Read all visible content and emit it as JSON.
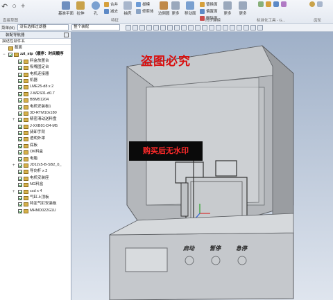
{
  "ribbon": {
    "quick_access": [
      "↶",
      "○",
      "+"
    ],
    "items": [
      {
        "label": "基准平面",
        "color": "#6f8fbf"
      },
      {
        "label": "拉伸",
        "color": "#c9a24a"
      },
      {
        "label": "孔",
        "color": "#7aa0d0"
      },
      {
        "label": "抽壳",
        "color": "#a8b6cc"
      },
      {
        "label": "边倒圆",
        "color": "#c08a4a"
      },
      {
        "label": "更多",
        "color": "#9aa8bc"
      },
      {
        "label": "移动面",
        "color": "#7aa0d0"
      },
      {
        "label": "更多",
        "color": "#9aa8bc"
      },
      {
        "label": "更多",
        "color": "#9aa8bc"
      }
    ],
    "small_items": [
      "合并",
      "减去",
      "拔模",
      "修剪体",
      "替换面",
      "偏置面",
      "删除面"
    ],
    "groups": [
      "直接草图",
      "特征",
      "同步建模",
      "标准化工具 - G...",
      "齿轮"
    ]
  },
  "selection_bar": {
    "menu_label": "菜单(M)",
    "filter_value": "没有选择过滤器",
    "assembly_value": "整个装配"
  },
  "nav": {
    "title": "装配导航器",
    "filter_label": "描述性部件名",
    "items": [
      {
        "label": "截面",
        "level": 0,
        "expander": "",
        "checkbox": false,
        "bold": false
      },
      {
        "label": "zzt_stp（顺序：时间顺序",
        "level": 0,
        "expander": "−",
        "checkbox": true,
        "bold": true
      },
      {
        "label": "料盒放置台",
        "level": 1,
        "expander": "",
        "checkbox": true,
        "bold": false
      },
      {
        "label": "吸嘴固定台",
        "level": 1,
        "expander": "",
        "checkbox": true,
        "bold": false
      },
      {
        "label": "电机连接器",
        "level": 1,
        "expander": "",
        "checkbox": true,
        "bold": false
      },
      {
        "label": "机器",
        "level": 1,
        "expander": "",
        "checkbox": true,
        "bold": false
      },
      {
        "label": "LME25-d8 x 2",
        "level": 1,
        "expander": "",
        "checkbox": true,
        "bold": false
      },
      {
        "label": "J-WES01-d0.7",
        "level": 1,
        "expander": "",
        "checkbox": true,
        "bold": false
      },
      {
        "label": "BBM51204",
        "level": 1,
        "expander": "",
        "checkbox": true,
        "bold": false
      },
      {
        "label": "电机安装板1",
        "level": 1,
        "expander": "",
        "checkbox": true,
        "bold": false
      },
      {
        "label": "3D-RTM10x180",
        "level": 1,
        "expander": "",
        "checkbox": true,
        "bold": false
      },
      {
        "label": "精密滑动送料盘",
        "level": 1,
        "expander": "+",
        "checkbox": true,
        "bold": false
      },
      {
        "label": "J-XXB01-D4-M5",
        "level": 1,
        "expander": "",
        "checkbox": true,
        "bold": false
      },
      {
        "label": "骑卸手臂",
        "level": 1,
        "expander": "",
        "checkbox": true,
        "bold": false
      },
      {
        "label": "透明外罩",
        "level": 1,
        "expander": "",
        "checkbox": true,
        "bold": false
      },
      {
        "label": "底板",
        "level": 1,
        "expander": "",
        "checkbox": true,
        "bold": false
      },
      {
        "label": "OK料盒",
        "level": 1,
        "expander": "",
        "checkbox": true,
        "bold": false
      },
      {
        "label": "电箱",
        "level": 1,
        "expander": "",
        "checkbox": true,
        "bold": false
      },
      {
        "label": "JD12x5-B-SB2_0_",
        "level": 1,
        "expander": "+",
        "checkbox": true,
        "bold": false
      },
      {
        "label": "导向杆 x 2",
        "level": 1,
        "expander": "",
        "checkbox": true,
        "bold": false
      },
      {
        "label": "电机安装座",
        "level": 1,
        "expander": "",
        "checkbox": true,
        "bold": false
      },
      {
        "label": "NG料盒",
        "level": 1,
        "expander": "",
        "checkbox": true,
        "bold": false
      },
      {
        "label": "ccd x 4",
        "level": 1,
        "expander": "+",
        "checkbox": true,
        "bold": false
      },
      {
        "label": "气缸上顶板",
        "level": 1,
        "expander": "",
        "checkbox": true,
        "bold": false
      },
      {
        "label": "特定气缸安装板",
        "level": 1,
        "expander": "",
        "checkbox": true,
        "bold": false
      },
      {
        "label": "MHMD022G1U",
        "level": 1,
        "expander": "",
        "checkbox": true,
        "bold": false
      }
    ]
  },
  "viewport": {
    "watermark_top": "盗图必究",
    "watermark_mid": "购买后无水印",
    "panel_labels": [
      "启动",
      "暂停",
      "急停"
    ],
    "colors": {
      "body": "#b4b7bb",
      "body_dark": "#8f9296",
      "cover": "#c5c8cc",
      "inner": "#d3d6d9"
    }
  }
}
